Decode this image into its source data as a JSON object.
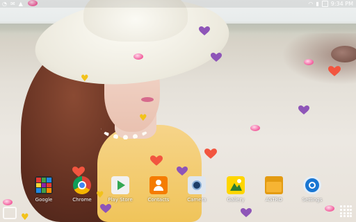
{
  "status_bar": {
    "time": "9:34 PM",
    "left_icons": [
      "notification-icon",
      "mail-icon",
      "alert-icon"
    ],
    "right_icons": [
      "wifi-icon",
      "signal-icon",
      "battery-icon"
    ]
  },
  "dock": {
    "apps": [
      {
        "label": "Google",
        "icon": "google-folder-icon"
      },
      {
        "label": "Chrome",
        "icon": "chrome-icon"
      },
      {
        "label": "Play Store",
        "icon": "play-store-icon"
      },
      {
        "label": "Contacts",
        "icon": "contacts-icon"
      },
      {
        "label": "Camera",
        "icon": "camera-icon"
      },
      {
        "label": "Gallery",
        "icon": "gallery-icon"
      },
      {
        "label": "ASTRO",
        "icon": "astro-icon"
      },
      {
        "label": "Settings",
        "icon": "settings-icon"
      }
    ]
  },
  "colors": {
    "heart_purple": "#8e55b8",
    "heart_red": "#f2553f",
    "gem_pink": "#f25c9c",
    "gold": "#f2c21a",
    "label_text": "#ffffff"
  }
}
